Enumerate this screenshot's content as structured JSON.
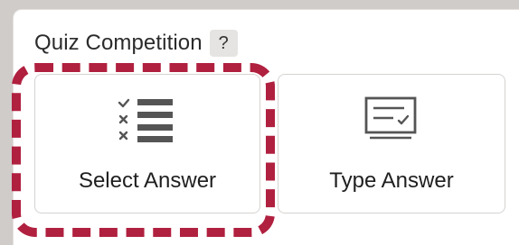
{
  "section": {
    "title": "Quiz Competition",
    "help_label": "?"
  },
  "options": [
    {
      "label": "Select Answer",
      "icon": "checklist-icon",
      "highlighted": true
    },
    {
      "label": "Type Answer",
      "icon": "text-input-icon",
      "highlighted": false
    }
  ],
  "colors": {
    "highlight": "#b0203f",
    "icon": "#555555"
  }
}
